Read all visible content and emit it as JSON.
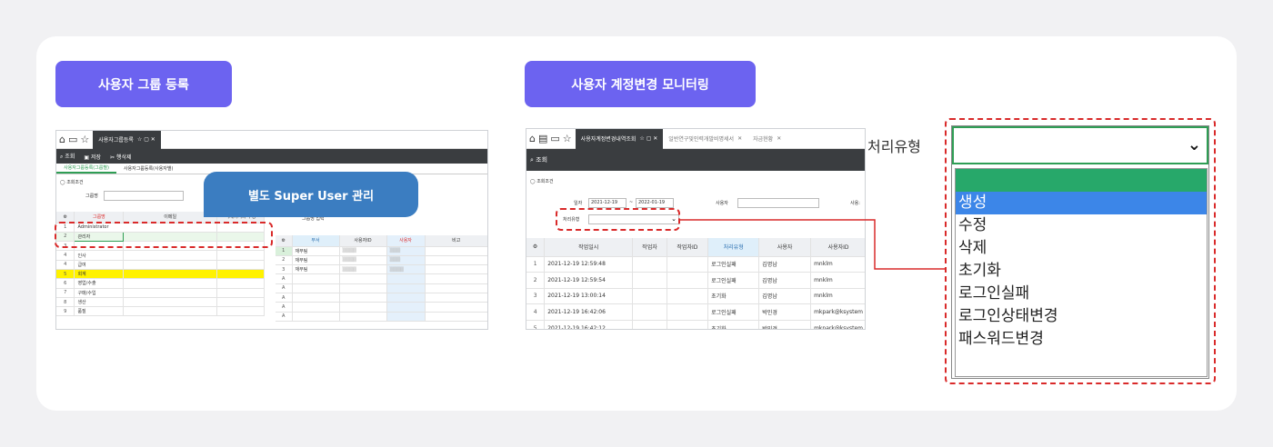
{
  "left": {
    "pill": "사용자 그룹 등록",
    "tabbar": {
      "tab": "사용자그룹등록"
    },
    "toolbar": {
      "search": "조회",
      "save": "저장",
      "delete": "행삭제"
    },
    "subtabs": [
      "사용자그룹등록(그룹별)",
      "사용자그룹등록(사용자별)"
    ],
    "search_title": "조회조건",
    "group_name_label": "그룹명",
    "tooltip": "별도 Super User 관리",
    "hidden_header": "그룹명 입력",
    "grid1": {
      "headers": [
        "",
        "그룹명",
        "이메일",
        "삭제하거나 수정"
      ],
      "rows": [
        {
          "n": "1",
          "name": "Administrator"
        },
        {
          "n": "2",
          "name": "관리자"
        },
        {
          "n": "3",
          "name": ""
        },
        {
          "n": "4",
          "name": "인사"
        },
        {
          "n": "4",
          "name": "급여"
        },
        {
          "n": "5",
          "name": "회계"
        },
        {
          "n": "6",
          "name": "영업/수출"
        },
        {
          "n": "7",
          "name": "구매/수입"
        },
        {
          "n": "8",
          "name": "생산"
        },
        {
          "n": "9",
          "name": "품질"
        }
      ]
    },
    "grid2": {
      "headers": [
        "",
        "부서",
        "사용자ID",
        "사용자",
        "비고"
      ],
      "rows": [
        {
          "n": "1",
          "dept": "재무팀"
        },
        {
          "n": "2",
          "dept": "재무팀"
        },
        {
          "n": "3",
          "dept": "재무팀"
        },
        {
          "n": "A",
          "dept": ""
        },
        {
          "n": "A",
          "dept": ""
        },
        {
          "n": "A",
          "dept": ""
        },
        {
          "n": "A",
          "dept": ""
        },
        {
          "n": "A",
          "dept": ""
        }
      ]
    }
  },
  "right": {
    "pill": "사용자 계정변경 모니터링",
    "tabbar": {
      "tab1": "사용자계정변경내역조회",
      "tab2": "일반연구및인력개발비명세서",
      "tab3": "자금현황"
    },
    "toolbar": {
      "search": "조회"
    },
    "search_title": "조회조건",
    "date_label": "일자",
    "date_from": "2021-12-19",
    "date_sep": "~",
    "date_to": "2022-01-19",
    "user_label": "사용자",
    "user_label2": "사용:",
    "process_label": "처리유형",
    "grid": {
      "headers": [
        "",
        "작업일시",
        "작업자",
        "작업자ID",
        "처리유형",
        "사용자",
        "사용자ID"
      ],
      "rows": [
        {
          "n": "1",
          "dt": "2021-12-19 12:59:48",
          "type": "로그인실패",
          "user": "김명남",
          "uid": "mnklm"
        },
        {
          "n": "2",
          "dt": "2021-12-19 12:59:54",
          "type": "로그인실패",
          "user": "김명남",
          "uid": "mnklm"
        },
        {
          "n": "3",
          "dt": "2021-12-19 13:00:14",
          "type": "초기화",
          "user": "김명남",
          "uid": "mnklm"
        },
        {
          "n": "4",
          "dt": "2021-12-19 16:42:06",
          "type": "로그인실패",
          "user": "박민경",
          "uid": "mkpark@ksystem"
        },
        {
          "n": "5",
          "dt": "2021-12-19 16:42:12",
          "type": "초기화",
          "user": "박민경",
          "uid": "mkpark@ksystem"
        }
      ]
    },
    "zoom_label": "처리유형",
    "dropdown_options": [
      "",
      "생성",
      "수정",
      "삭제",
      "초기화",
      "로그인실패",
      "로그인상태변경",
      "패스워드변경"
    ]
  }
}
